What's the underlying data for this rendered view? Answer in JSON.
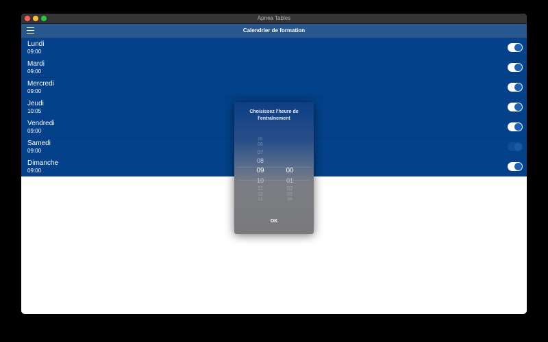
{
  "window": {
    "title": "Apnea Tables"
  },
  "navbar": {
    "title": "Calendrier de formation",
    "menu_icon": "hamburger-icon"
  },
  "days": [
    {
      "day": "Lundi",
      "time": "09:00",
      "enabled": true
    },
    {
      "day": "Mardi",
      "time": "09:00",
      "enabled": true
    },
    {
      "day": "Mercredi",
      "time": "09:00",
      "enabled": true
    },
    {
      "day": "Jeudi",
      "time": "10:05",
      "enabled": true
    },
    {
      "day": "Vendredi",
      "time": "09:00",
      "enabled": true
    },
    {
      "day": "Samedi",
      "time": "09:00",
      "enabled": false
    },
    {
      "day": "Dimanche",
      "time": "09:00",
      "enabled": true
    }
  ],
  "picker": {
    "title": "Choisissez l'heure de l'entraînement",
    "hours": {
      "above": [
        "05",
        "06",
        "07",
        "08"
      ],
      "selected": "09",
      "below": [
        "10",
        "11",
        "12",
        "13"
      ]
    },
    "minutes": {
      "selected": "00",
      "below": [
        "01",
        "02",
        "03",
        "04"
      ]
    },
    "ok_label": "OK"
  },
  "colors": {
    "list_bg": "#03418a",
    "navbar_bg": "#28578f",
    "toggle_knob": "#1b60b4"
  }
}
